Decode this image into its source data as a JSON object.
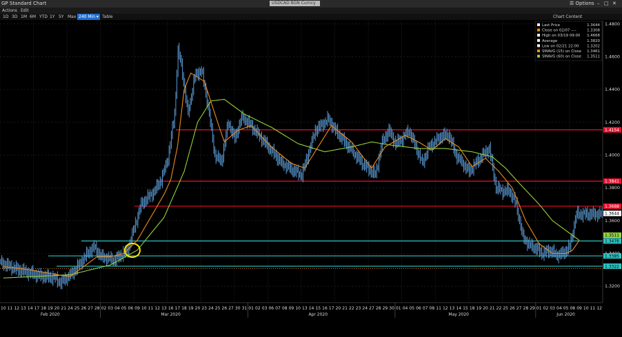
{
  "window": {
    "title": "GP Standard Chart",
    "ticker": "USDCAD BGN Curncy",
    "options_label": "Options",
    "win_icons": [
      "minimize-icon",
      "maximize-icon",
      "close-icon"
    ]
  },
  "toolbar": {
    "actions": "Actions",
    "edit": "Edit"
  },
  "ranges": {
    "items": [
      "1D",
      "3D",
      "1M",
      "6M",
      "YTD",
      "1Y",
      "5Y",
      "Max"
    ],
    "interval": "240 Min",
    "table": "Table",
    "chart_content": "Chart Content"
  },
  "colors": {
    "price": "#5b9bd5",
    "sma15": "#f08c1e",
    "sma60": "#96d23c",
    "red_line": "#e8112d",
    "cyan_line": "#2fc4c4",
    "grid": "#2a2a2a",
    "circle": "#ffe600"
  },
  "chart_data": {
    "type": "line",
    "title": "",
    "ylim": [
      1.31,
      1.482
    ],
    "y_ticks": [
      "1.4800",
      "1.4600",
      "1.4400",
      "1.4200",
      "1.4000",
      "1.3800",
      "1.3600",
      "1.3400",
      "1.3200"
    ],
    "legend": [
      {
        "label": "Last Price",
        "value": "1.3644",
        "color": "#ffffff"
      },
      {
        "label": "Close on 02/07 ----",
        "value": "1.3308",
        "color": "#f08c1e"
      },
      {
        "label": "High on 03/19 09:00",
        "value": "1.4668",
        "color": "#ffffff"
      },
      {
        "label": "Average",
        "value": "1.3820",
        "color": "#ffffff"
      },
      {
        "label": "Low on 02/21 22:00",
        "value": "1.3202",
        "color": "#ffffff"
      },
      {
        "label": "SMAVG (15) on Close",
        "value": "1.3461",
        "color": "#f08c1e"
      },
      {
        "label": "SMAVG (60) on Close",
        "value": "1.3511",
        "color": "#96d23c"
      }
    ],
    "hlines": [
      {
        "value": 1.4154,
        "color": "#e8112d",
        "label": "1.4154"
      },
      {
        "value": 1.3841,
        "color": "#e8112d",
        "label": "1.3841"
      },
      {
        "value": 1.3688,
        "color": "#e8112d",
        "label": "1.3688"
      },
      {
        "value": 1.3476,
        "color": "#2fc4c4",
        "label": "1.3476"
      },
      {
        "value": 1.3385,
        "color": "#2fc4c4",
        "label": "1.3385"
      },
      {
        "value": 1.3322,
        "color": "#2fc4c4",
        "label": "1.3322"
      }
    ],
    "right_labels": [
      {
        "value": 1.3644,
        "text": "1.3644",
        "bg": "#ffffff",
        "fg": "#000000"
      },
      {
        "value": 1.3511,
        "text": "1.3511",
        "bg": "#96d23c",
        "fg": "#000000"
      }
    ],
    "x_days": [
      "10",
      "11",
      "12",
      "13",
      "14",
      "17",
      "18",
      "19",
      "20",
      "21",
      "24",
      "25",
      "26",
      "27",
      "28",
      "02",
      "03",
      "04",
      "05",
      "06",
      "09",
      "10",
      "11",
      "12",
      "13",
      "16",
      "17",
      "18",
      "19",
      "20",
      "23",
      "24",
      "25",
      "26",
      "27",
      "30",
      "31",
      "01",
      "02",
      "03",
      "06",
      "07",
      "08",
      "09",
      "10",
      "13",
      "14",
      "15",
      "16",
      "17",
      "20",
      "21",
      "22",
      "23",
      "24",
      "27",
      "28",
      "29",
      "30",
      "01",
      "04",
      "05",
      "06",
      "07",
      "08",
      "11",
      "12",
      "13",
      "14",
      "15",
      "18",
      "19",
      "20",
      "21",
      "22",
      "25",
      "26",
      "27",
      "28",
      "29",
      "01",
      "02",
      "03",
      "04",
      "05",
      "08",
      "09",
      "10",
      "11",
      "12"
    ],
    "x_months": [
      {
        "label": "Feb 2020",
        "index": 7
      },
      {
        "label": "Mar 2020",
        "index": 25
      },
      {
        "label": "Apr 2020",
        "index": 47
      },
      {
        "label": "May 2020",
        "index": 68
      },
      {
        "label": "Jun 2020",
        "index": 84
      }
    ],
    "price_anchors": [
      [
        0,
        1.3345
      ],
      [
        2,
        1.331
      ],
      [
        4,
        1.3285
      ],
      [
        6,
        1.3262
      ],
      [
        8,
        1.3252
      ],
      [
        9,
        1.3222
      ],
      [
        11,
        1.329
      ],
      [
        13,
        1.34
      ],
      [
        14,
        1.344
      ],
      [
        15,
        1.338
      ],
      [
        17,
        1.336
      ],
      [
        19,
        1.342
      ],
      [
        20,
        1.356
      ],
      [
        21,
        1.37
      ],
      [
        23,
        1.378
      ],
      [
        24,
        1.385
      ],
      [
        25,
        1.398
      ],
      [
        26,
        1.425
      ],
      [
        26.5,
        1.464
      ],
      [
        27,
        1.455
      ],
      [
        28,
        1.425
      ],
      [
        29,
        1.448
      ],
      [
        30,
        1.452
      ],
      [
        31,
        1.43
      ],
      [
        32,
        1.4
      ],
      [
        33,
        1.396
      ],
      [
        34,
        1.42
      ],
      [
        35,
        1.41
      ],
      [
        36,
        1.423
      ],
      [
        37,
        1.42
      ],
      [
        38,
        1.415
      ],
      [
        39,
        1.41
      ],
      [
        40,
        1.405
      ],
      [
        42,
        1.395
      ],
      [
        44,
        1.39
      ],
      [
        45,
        1.388
      ],
      [
        47,
        1.415
      ],
      [
        49,
        1.422
      ],
      [
        50,
        1.415
      ],
      [
        52,
        1.405
      ],
      [
        54,
        1.395
      ],
      [
        56,
        1.388
      ],
      [
        57,
        1.408
      ],
      [
        58,
        1.415
      ],
      [
        59,
        1.407
      ],
      [
        60,
        1.41
      ],
      [
        61,
        1.415
      ],
      [
        62,
        1.405
      ],
      [
        63,
        1.395
      ],
      [
        64,
        1.405
      ],
      [
        66,
        1.412
      ],
      [
        67,
        1.412
      ],
      [
        68,
        1.4
      ],
      [
        69,
        1.395
      ],
      [
        70,
        1.39
      ],
      [
        72,
        1.4
      ],
      [
        73,
        1.404
      ],
      [
        74,
        1.38
      ],
      [
        75,
        1.378
      ],
      [
        76,
        1.378
      ],
      [
        77,
        1.37
      ],
      [
        78,
        1.35
      ],
      [
        79,
        1.345
      ],
      [
        80,
        1.343
      ],
      [
        81,
        1.34
      ],
      [
        82,
        1.342
      ],
      [
        83,
        1.339
      ],
      [
        84,
        1.34
      ],
      [
        85,
        1.344
      ],
      [
        86,
        1.364
      ]
    ],
    "sma15_anchors": [
      [
        0,
        1.332
      ],
      [
        4,
        1.33
      ],
      [
        8,
        1.327
      ],
      [
        10,
        1.326
      ],
      [
        12,
        1.332
      ],
      [
        14,
        1.338
      ],
      [
        16,
        1.338
      ],
      [
        18,
        1.34
      ],
      [
        20,
        1.348
      ],
      [
        22,
        1.362
      ],
      [
        24,
        1.376
      ],
      [
        25,
        1.385
      ],
      [
        26,
        1.405
      ],
      [
        27,
        1.44
      ],
      [
        28,
        1.45
      ],
      [
        30,
        1.445
      ],
      [
        32,
        1.42
      ],
      [
        33,
        1.408
      ],
      [
        35,
        1.415
      ],
      [
        37,
        1.418
      ],
      [
        40,
        1.405
      ],
      [
        43,
        1.395
      ],
      [
        45,
        1.392
      ],
      [
        47,
        1.405
      ],
      [
        49,
        1.418
      ],
      [
        52,
        1.408
      ],
      [
        55,
        1.392
      ],
      [
        57,
        1.405
      ],
      [
        60,
        1.412
      ],
      [
        62,
        1.408
      ],
      [
        64,
        1.403
      ],
      [
        66,
        1.41
      ],
      [
        68,
        1.405
      ],
      [
        70,
        1.393
      ],
      [
        72,
        1.398
      ],
      [
        74,
        1.39
      ],
      [
        76,
        1.38
      ],
      [
        78,
        1.36
      ],
      [
        80,
        1.346
      ],
      [
        82,
        1.34
      ],
      [
        84,
        1.34
      ],
      [
        85,
        1.342
      ],
      [
        86,
        1.348
      ]
    ],
    "sma60_anchors": [
      [
        0,
        1.325
      ],
      [
        10,
        1.327
      ],
      [
        16,
        1.333
      ],
      [
        20,
        1.342
      ],
      [
        24,
        1.362
      ],
      [
        27,
        1.39
      ],
      [
        29,
        1.42
      ],
      [
        31,
        1.433
      ],
      [
        33,
        1.434
      ],
      [
        36,
        1.425
      ],
      [
        40,
        1.417
      ],
      [
        44,
        1.407
      ],
      [
        48,
        1.402
      ],
      [
        52,
        1.405
      ],
      [
        55,
        1.408
      ],
      [
        58,
        1.406
      ],
      [
        62,
        1.404
      ],
      [
        66,
        1.404
      ],
      [
        70,
        1.402
      ],
      [
        73,
        1.399
      ],
      [
        75,
        1.392
      ],
      [
        77,
        1.383
      ],
      [
        80,
        1.37
      ],
      [
        82,
        1.36
      ],
      [
        84,
        1.354
      ],
      [
        86,
        1.348
      ]
    ],
    "highlight": {
      "index": 20,
      "value": 1.344,
      "color": "#ffe600"
    }
  }
}
